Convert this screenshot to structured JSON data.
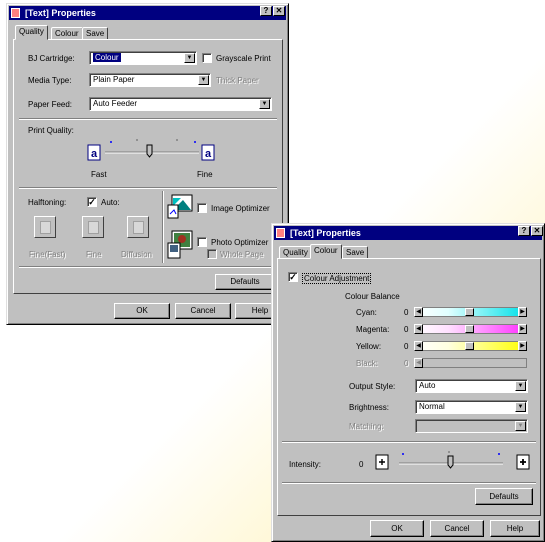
{
  "win1": {
    "title": "[Text] Properties",
    "help_btn": "?",
    "close_btn": "✕",
    "tabs": [
      "Quality",
      "Colour",
      "Save"
    ],
    "cartridge_label": "BJ Cartridge:",
    "cartridge_value": "Colour",
    "grayscale_label": "Grayscale Print",
    "media_label": "Media Type:",
    "media_value": "Plain Paper",
    "thick_label": "Thick Paper",
    "feed_label": "Paper Feed:",
    "feed_value": "Auto Feeder",
    "quality_label": "Print Quality:",
    "fast": "Fast",
    "fine": "Fine",
    "halftoning_label": "Halftoning:",
    "auto_label": "Auto:",
    "ht_fine_fast": "Fine(Fast)",
    "ht_fine": "Fine",
    "ht_diffusion": "Diffusion",
    "image_opt": "Image Optimizer",
    "photo_opt": "Photo Optimizer",
    "whole_page": "Whole Page",
    "defaults": "Defaults",
    "ok": "OK",
    "cancel": "Cancel",
    "help": "Help"
  },
  "win2": {
    "title": "[Text] Properties",
    "help_btn": "?",
    "close_btn": "✕",
    "tabs": [
      "Quality",
      "Colour",
      "Save"
    ],
    "colour_adj": "Colour Adjustment",
    "balance_label": "Colour Balance",
    "cyan": "Cyan:",
    "magenta": "Magenta:",
    "yellow": "Yellow:",
    "black": "Black:",
    "cyan_val": "0",
    "magenta_val": "0",
    "yellow_val": "0",
    "black_val": "0",
    "style_label": "Output Style:",
    "style_value": "Auto",
    "bright_label": "Brightness:",
    "bright_value": "Normal",
    "match_label": "Matching:",
    "intensity_label": "Intensity:",
    "intensity_val": "0",
    "defaults": "Defaults",
    "ok": "OK",
    "cancel": "Cancel",
    "help": "Help"
  },
  "colors": {
    "title_bar": "#000080",
    "face": "#c0c0c0",
    "cyan": "#00e0e8",
    "magenta": "#ff30ff",
    "yellow": "#ffff00"
  }
}
